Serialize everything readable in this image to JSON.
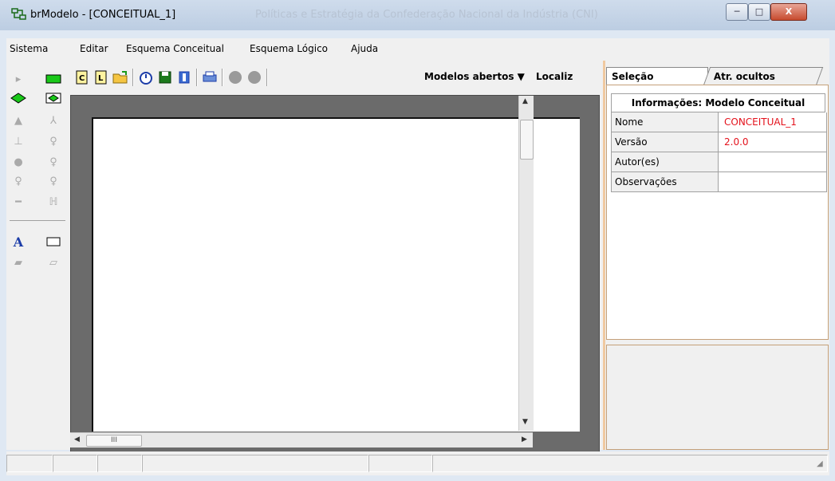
{
  "window": {
    "title": "brModelo - [CONCEITUAL_1]",
    "watermark": "Políticas e Estratégia da Confederação Nacional da Indústria (CNI)",
    "minimize": "─",
    "maximize": "□",
    "close": "X"
  },
  "menu": [
    "Sistema",
    "Editar",
    "Esquema Conceitual",
    "Esquema Lógico",
    "Ajuda"
  ],
  "toolbar": {
    "models_label": "Modelos abertos",
    "models_arrow": "▼",
    "localizar": "Localiz"
  },
  "panel": {
    "tab_selected": "Seleção",
    "tab_hidden": "Atr. ocultos",
    "info_title": "Informações: Modelo Conceitual",
    "rows": [
      {
        "key": "Nome",
        "value": "CONCEITUAL_1"
      },
      {
        "key": "Versão",
        "value": "2.0.0"
      },
      {
        "key": "Autor(es)",
        "value": ""
      },
      {
        "key": "Observações",
        "value": ""
      }
    ]
  },
  "scroll": {
    "h_thumb": "III"
  },
  "colors": {
    "value_text": "#e4121c",
    "canvas_bg": "#6b6b6b",
    "title_bar": "#c5d5e8"
  }
}
